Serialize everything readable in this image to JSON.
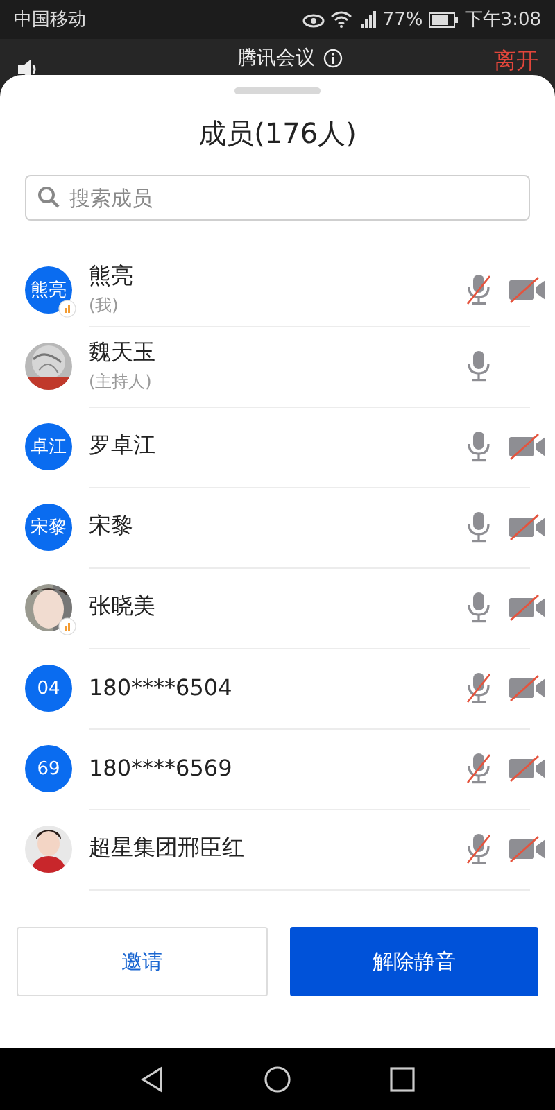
{
  "status_bar": {
    "carrier": "中国移动",
    "battery": "77%",
    "time": "下午3:08"
  },
  "header": {
    "title": "腾讯会议",
    "leave": "离开"
  },
  "sheet": {
    "title": "成员(176人)",
    "search": {
      "placeholder": "搜索成员"
    }
  },
  "members": [
    {
      "name": "熊亮",
      "role": "(我)",
      "avatar": {
        "kind": "initials",
        "text": "熊亮"
      },
      "speaking": true,
      "mic_muted": true,
      "camera_shown": true,
      "camera_muted": true
    },
    {
      "name": "魏天玉",
      "role": "(主持人)",
      "speaking": false,
      "mic_muted": false,
      "camera_shown": false
    },
    {
      "name": "罗卓江",
      "avatar": {
        "kind": "initials",
        "text": "卓江"
      },
      "speaking": false,
      "mic_muted": false,
      "camera_shown": true,
      "camera_muted": true
    },
    {
      "name": "宋黎",
      "avatar": {
        "kind": "initials",
        "text": "宋黎"
      },
      "speaking": false,
      "mic_muted": false,
      "camera_shown": true,
      "camera_muted": true
    },
    {
      "name": "张晓美",
      "speaking": true,
      "mic_muted": false,
      "camera_shown": true,
      "camera_muted": true
    },
    {
      "name": "180****6504",
      "avatar": {
        "kind": "initials",
        "text": "04"
      },
      "speaking": false,
      "mic_muted": true,
      "camera_shown": true,
      "camera_muted": true
    },
    {
      "name": "180****6569",
      "avatar": {
        "kind": "initials",
        "text": "69"
      },
      "speaking": false,
      "mic_muted": true,
      "camera_shown": true,
      "camera_muted": true
    },
    {
      "name": "超星集团邢臣红",
      "speaking": false,
      "mic_muted": true,
      "camera_shown": true,
      "camera_muted": true
    }
  ],
  "buttons": {
    "invite": "邀请",
    "unmute": "解除静音"
  }
}
